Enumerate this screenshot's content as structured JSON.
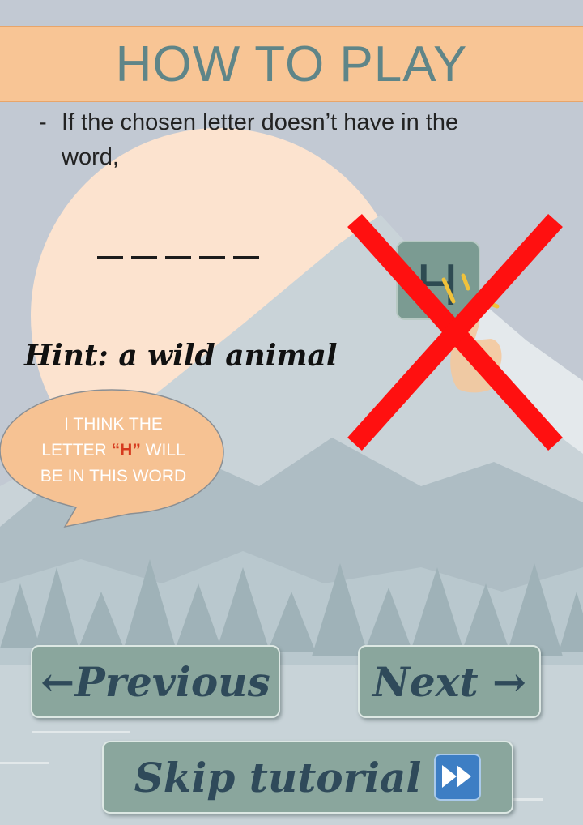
{
  "screen": {
    "title": "HOW TO PLAY",
    "rule_dash": "-",
    "rule_text": "If the chosen letter doesn’t have in the word,",
    "blank_count": 5,
    "hint": "Hint: a wild animal",
    "speech": {
      "line1": "I THINK THE",
      "line2_before": "LETTER ",
      "line2_highlight": "“H”",
      "line2_after": " WILL",
      "line3": "BE IN THIS WORD"
    },
    "letter_tile": "H"
  },
  "buttons": {
    "previous": "←Previous",
    "next": "Next →",
    "skip": "Skip tutorial"
  },
  "icons": {
    "cross": "red-x-icon",
    "fast_forward": "fast-forward-icon",
    "tap": "tap-hand-icon"
  },
  "colors": {
    "banner": "#f8c595",
    "title": "#5f8588",
    "button": "#8aa69d",
    "button_text": "#2f4a5a",
    "cross": "#ff0000",
    "highlight": "#d63a1e",
    "bubble": "#f6c293"
  }
}
